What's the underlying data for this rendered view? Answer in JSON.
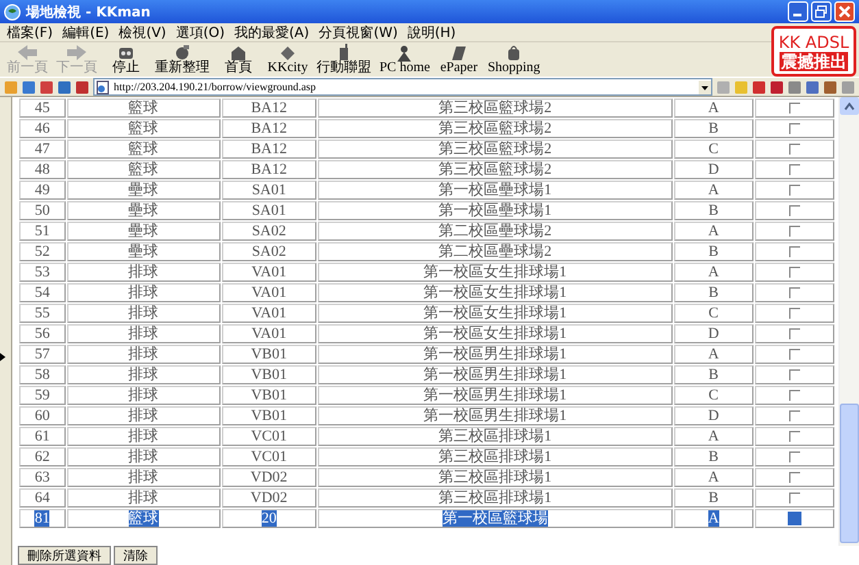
{
  "window": {
    "title": "場地檢視 - KKman"
  },
  "menu": [
    "檔案(F)",
    "編輯(E)",
    "檢視(V)",
    "選項(O)",
    "我的最愛(A)",
    "分頁視窗(W)",
    "說明(H)"
  ],
  "toolbar": [
    {
      "label": "前一頁",
      "disabled": true
    },
    {
      "label": "下一頁",
      "disabled": true
    },
    {
      "label": "停止",
      "disabled": false
    },
    {
      "label": "重新整理",
      "disabled": false
    },
    {
      "label": "首頁",
      "disabled": false
    },
    {
      "label": "KKcity",
      "disabled": false
    },
    {
      "label": "行動聯盟",
      "disabled": false
    },
    {
      "label": "PC home",
      "disabled": false
    },
    {
      "label": "ePaper",
      "disabled": false
    },
    {
      "label": "Shopping",
      "disabled": false
    }
  ],
  "ad": {
    "line1": "KK ADSL",
    "line2": "震撼推出"
  },
  "address": {
    "value": "http://203.204.190.21/borrow/viewground.asp"
  },
  "table": {
    "rows": [
      {
        "cells": [
          "45",
          "籃球",
          "BA12",
          "第三校區籃球場2",
          "A"
        ],
        "checked": false,
        "selected": false
      },
      {
        "cells": [
          "46",
          "籃球",
          "BA12",
          "第三校區籃球場2",
          "B"
        ],
        "checked": false,
        "selected": false
      },
      {
        "cells": [
          "47",
          "籃球",
          "BA12",
          "第三校區籃球場2",
          "C"
        ],
        "checked": false,
        "selected": false
      },
      {
        "cells": [
          "48",
          "籃球",
          "BA12",
          "第三校區籃球場2",
          "D"
        ],
        "checked": false,
        "selected": false
      },
      {
        "cells": [
          "49",
          "壘球",
          "SA01",
          "第一校區壘球場1",
          "A"
        ],
        "checked": false,
        "selected": false
      },
      {
        "cells": [
          "50",
          "壘球",
          "SA01",
          "第一校區壘球場1",
          "B"
        ],
        "checked": false,
        "selected": false
      },
      {
        "cells": [
          "51",
          "壘球",
          "SA02",
          "第二校區壘球場2",
          "A"
        ],
        "checked": false,
        "selected": false
      },
      {
        "cells": [
          "52",
          "壘球",
          "SA02",
          "第二校區壘球場2",
          "B"
        ],
        "checked": false,
        "selected": false
      },
      {
        "cells": [
          "53",
          "排球",
          "VA01",
          "第一校區女生排球場1",
          "A"
        ],
        "checked": false,
        "selected": false
      },
      {
        "cells": [
          "54",
          "排球",
          "VA01",
          "第一校區女生排球場1",
          "B"
        ],
        "checked": false,
        "selected": false
      },
      {
        "cells": [
          "55",
          "排球",
          "VA01",
          "第一校區女生排球場1",
          "C"
        ],
        "checked": false,
        "selected": false
      },
      {
        "cells": [
          "56",
          "排球",
          "VA01",
          "第一校區女生排球場1",
          "D"
        ],
        "checked": false,
        "selected": false
      },
      {
        "cells": [
          "57",
          "排球",
          "VB01",
          "第一校區男生排球場1",
          "A"
        ],
        "checked": false,
        "selected": false
      },
      {
        "cells": [
          "58",
          "排球",
          "VB01",
          "第一校區男生排球場1",
          "B"
        ],
        "checked": false,
        "selected": false
      },
      {
        "cells": [
          "59",
          "排球",
          "VB01",
          "第一校區男生排球場1",
          "C"
        ],
        "checked": false,
        "selected": false
      },
      {
        "cells": [
          "60",
          "排球",
          "VB01",
          "第一校區男生排球場1",
          "D"
        ],
        "checked": false,
        "selected": false
      },
      {
        "cells": [
          "61",
          "排球",
          "VC01",
          "第三校區排球場1",
          "A"
        ],
        "checked": false,
        "selected": false
      },
      {
        "cells": [
          "62",
          "排球",
          "VC01",
          "第三校區排球場1",
          "B"
        ],
        "checked": false,
        "selected": false
      },
      {
        "cells": [
          "63",
          "排球",
          "VD02",
          "第三校區排球場1",
          "A"
        ],
        "checked": false,
        "selected": false
      },
      {
        "cells": [
          "64",
          "排球",
          "VD02",
          "第三校區排球場1",
          "B"
        ],
        "checked": false,
        "selected": false
      },
      {
        "cells": [
          "81",
          "籃球",
          "20",
          "第一校區籃球場",
          "A"
        ],
        "checked": false,
        "selected": true
      }
    ]
  },
  "buttons": [
    "刪除所選資料",
    "清除"
  ]
}
